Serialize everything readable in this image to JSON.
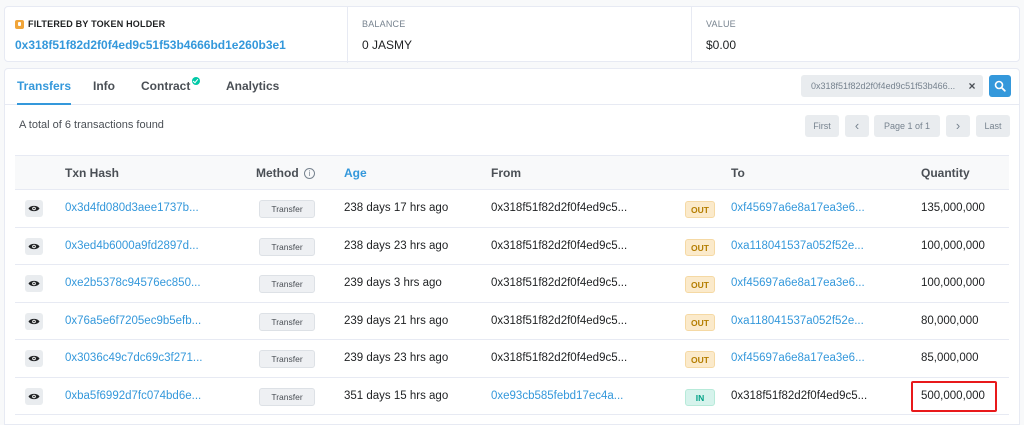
{
  "filter": {
    "holder_heading": "FILTERED BY TOKEN HOLDER",
    "holder_address": "0x318f51f82d2f0f4ed9c51f53b4666bd1e260b3e1",
    "balance_heading": "BALANCE",
    "balance_value": "0 JASMY",
    "value_heading": "VALUE",
    "value_value": "$0.00"
  },
  "tabs": [
    {
      "label": "Transfers",
      "active": true
    },
    {
      "label": "Info"
    },
    {
      "label": "Contract",
      "verified": true
    },
    {
      "label": "Analytics"
    }
  ],
  "search": {
    "value": "0x318f51f82d2f0f4ed9c51f53b466...",
    "clear_label": "×"
  },
  "total_text": "A total of 6 transactions found",
  "pager": {
    "first": "First",
    "prev": "‹",
    "page": "Page 1 of 1",
    "next": "›",
    "last": "Last"
  },
  "table": {
    "headers": {
      "txn_hash": "Txn Hash",
      "method": "Method",
      "age": "Age",
      "from": "From",
      "to": "To",
      "quantity": "Quantity"
    },
    "rows": [
      {
        "hash": "0x3d4fd080d3aee1737b...",
        "method": "Transfer",
        "age": "238 days 17 hrs ago",
        "from": "0x318f51f82d2f0f4ed9c5...",
        "direction": "OUT",
        "to": "0xf45697a6e8a17ea3e6...",
        "quantity": "135,000,000"
      },
      {
        "hash": "0x3ed4b6000a9fd2897d...",
        "method": "Transfer",
        "age": "238 days 23 hrs ago",
        "from": "0x318f51f82d2f0f4ed9c5...",
        "direction": "OUT",
        "to": "0xa118041537a052f52e...",
        "quantity": "100,000,000"
      },
      {
        "hash": "0xe2b5378c94576ec850...",
        "method": "Transfer",
        "age": "239 days 3 hrs ago",
        "from": "0x318f51f82d2f0f4ed9c5...",
        "direction": "OUT",
        "to": "0xf45697a6e8a17ea3e6...",
        "quantity": "100,000,000"
      },
      {
        "hash": "0x76a5e6f7205ec9b5efb...",
        "method": "Transfer",
        "age": "239 days 21 hrs ago",
        "from": "0x318f51f82d2f0f4ed9c5...",
        "direction": "OUT",
        "to": "0xa118041537a052f52e...",
        "quantity": "80,000,000"
      },
      {
        "hash": "0x3036c49c7dc69c3f271...",
        "method": "Transfer",
        "age": "239 days 23 hrs ago",
        "from": "0x318f51f82d2f0f4ed9c5...",
        "direction": "OUT",
        "to": "0xf45697a6e8a17ea3e6...",
        "quantity": "85,000,000"
      },
      {
        "hash": "0xba5f6992d7fc074bd6e...",
        "method": "Transfer",
        "age": "351 days 15 hrs ago",
        "from": "0xe93cb585febd17ec4a...",
        "direction": "IN",
        "to": "0x318f51f82d2f0f4ed9c5...",
        "quantity": "500,000,000",
        "highlighted": true
      }
    ]
  },
  "colors": {
    "accent": "#3498db",
    "out_badge": "#fbeacb",
    "in_badge": "#d6f3ec",
    "highlight": "#e8191b"
  }
}
